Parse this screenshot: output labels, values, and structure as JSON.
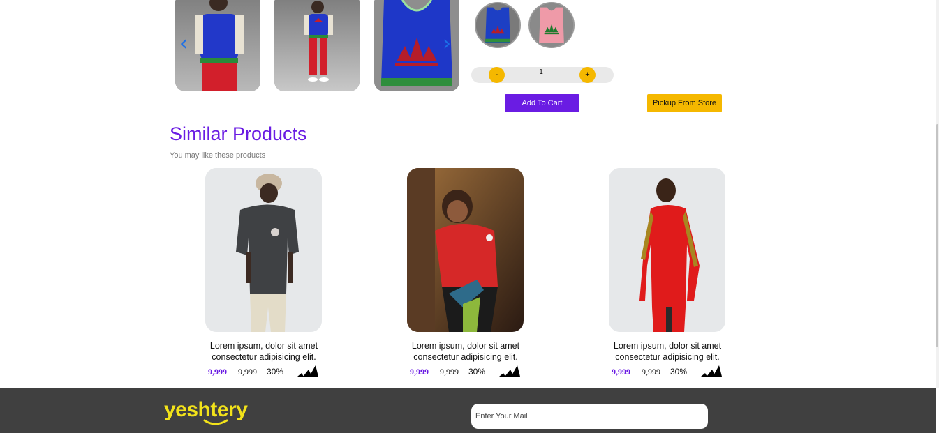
{
  "gallery": {
    "thumbnails": [
      {
        "name": "back view",
        "icon": "product-photo"
      },
      {
        "name": "model full view",
        "icon": "product-photo"
      },
      {
        "name": "product front view",
        "icon": "product-photo"
      }
    ],
    "prev_icon": "chevron-left-icon",
    "next_icon": "chevron-right-icon",
    "prev_glyph": "‹",
    "next_glyph": "›",
    "accent": "#1b6fe8"
  },
  "color_swatches": [
    {
      "color": "#1d3fc4",
      "logo_color": "#b51d2a"
    },
    {
      "color": "#ef9aa8",
      "logo_color": "#1f7a2e"
    }
  ],
  "quantity": {
    "minus_label": "-",
    "value": "1",
    "plus_label": "+"
  },
  "actions": {
    "add_to_cart": "Add To Cart",
    "pickup": "Pickup From Store"
  },
  "similar": {
    "title": "Similar Products",
    "subtitle": "You may like these products",
    "products": [
      {
        "name": "Lorem ipsum, dolor sit amet consectetur adipisicing elit.",
        "price": "9,999",
        "old_price": "9,999",
        "discount": "30%"
      },
      {
        "name": "Lorem ipsum, dolor sit amet consectetur adipisicing elit.",
        "price": "9,999",
        "old_price": "9,999",
        "discount": "30%"
      },
      {
        "name": "Lorem ipsum, dolor sit amet consectetur adipisicing elit.",
        "price": "9,999",
        "old_price": "9,999",
        "discount": "30%"
      }
    ]
  },
  "footer": {
    "logo_text": "yeshtery",
    "mail_placeholder": "Enter Your Mail"
  },
  "colors": {
    "brand_purple": "#6a1ce3",
    "brand_yellow": "#f5b800",
    "footer_bg": "#404040",
    "logo_yellow": "#f2e21a"
  }
}
